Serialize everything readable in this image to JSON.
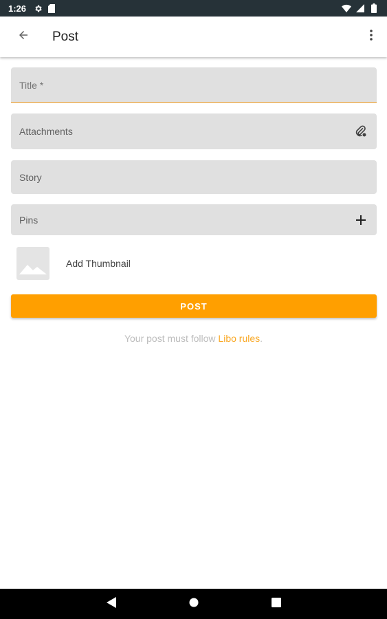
{
  "status_bar": {
    "time": "1:26",
    "left_icons": [
      "settings-icon",
      "sd-card-icon"
    ],
    "right_icons": [
      "wifi-icon",
      "signal-icon",
      "battery-icon"
    ]
  },
  "app_bar": {
    "title": "Post",
    "back_icon": "arrow-back-icon",
    "menu_icon": "more-vert-icon"
  },
  "form": {
    "title_label": "Title *",
    "attachments_label": "Attachments",
    "attachments_icon": "attach-icon",
    "story_label": "Story",
    "pins_label": "Pins",
    "pins_icon": "plus-icon",
    "thumbnail_label": "Add Thumbnail",
    "thumbnail_icon": "image-placeholder-icon"
  },
  "post_button": {
    "label": "POST"
  },
  "rules": {
    "prefix": "Your post must follow ",
    "link": "Libo rules",
    "suffix": "."
  },
  "colors": {
    "accent": "#ff9f00",
    "status_bar": "#263238",
    "field_bg": "#e0e0e0",
    "link": "#f9a825"
  },
  "nav_bar": {
    "back_icon": "nav-back-icon",
    "home_icon": "nav-home-icon",
    "recents_icon": "nav-recents-icon"
  }
}
